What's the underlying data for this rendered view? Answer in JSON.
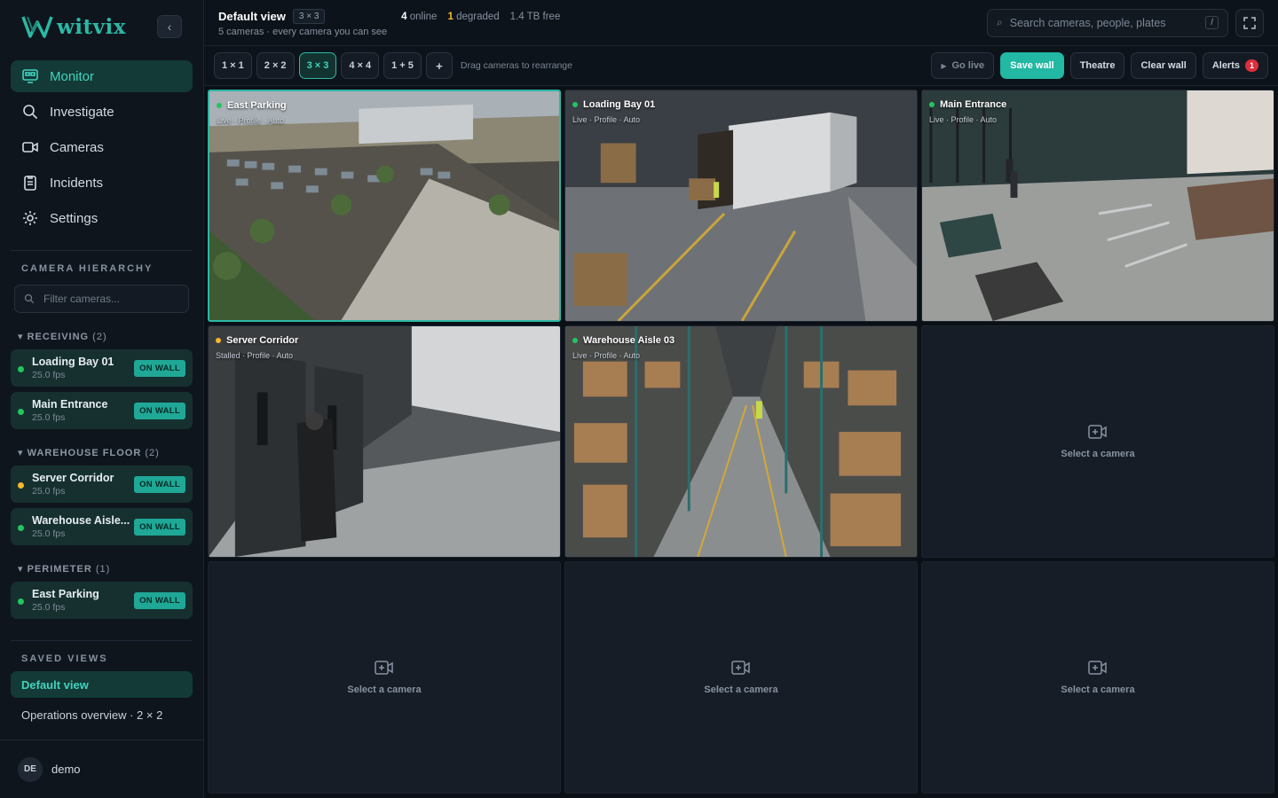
{
  "brand": {
    "name": "witvix"
  },
  "nav": [
    {
      "label": "Monitor",
      "icon": "monitor-icon",
      "active": true
    },
    {
      "label": "Investigate",
      "icon": "search-icon",
      "active": false
    },
    {
      "label": "Cameras",
      "icon": "camera-icon",
      "active": false
    },
    {
      "label": "Incidents",
      "icon": "clipboard-icon",
      "active": false
    },
    {
      "label": "Settings",
      "icon": "gear-icon",
      "active": false
    }
  ],
  "hierarchy": {
    "title": "CAMERA HIERARCHY",
    "filter_placeholder": "Filter cameras...",
    "groups": [
      {
        "name": "RECEIVING",
        "count": "(2)",
        "cameras": [
          {
            "name": "Loading Bay 01",
            "fps": "25.0 fps",
            "status": "online",
            "badge": "ON WALL"
          },
          {
            "name": "Main Entrance",
            "fps": "25.0 fps",
            "status": "online",
            "badge": "ON WALL"
          }
        ]
      },
      {
        "name": "WAREHOUSE FLOOR",
        "count": "(2)",
        "cameras": [
          {
            "name": "Server Corridor",
            "fps": "25.0 fps",
            "status": "degraded",
            "badge": "ON WALL"
          },
          {
            "name": "Warehouse Aisle...",
            "fps": "25.0 fps",
            "status": "online",
            "badge": "ON WALL"
          }
        ]
      },
      {
        "name": "PERIMETER",
        "count": "(1)",
        "cameras": [
          {
            "name": "East Parking",
            "fps": "25.0 fps",
            "status": "online",
            "badge": "ON WALL"
          }
        ]
      }
    ]
  },
  "saved_views": {
    "title": "SAVED VIEWS",
    "items": [
      {
        "label": "Default view",
        "active": true
      },
      {
        "label": "Operations overview · 2 × 2",
        "active": false
      }
    ]
  },
  "user": {
    "initials": "DE",
    "name": "demo"
  },
  "header": {
    "title": "Default view",
    "grid": "3 × 3",
    "subtitle": "5 cameras · every camera you can see",
    "online_count": "4",
    "online_label": "online",
    "degraded_count": "1",
    "degraded_label": "degraded",
    "storage": "1.4 TB free",
    "search_placeholder": "Search cameras, people, plates",
    "search_shortcut": "/"
  },
  "toolbar": {
    "layouts": [
      "1 × 1",
      "2 × 2",
      "3 × 3",
      "4 × 4",
      "1 + 5"
    ],
    "active_layout": "3 × 3",
    "add_label": "+",
    "hint": "Drag cameras to rearrange",
    "go_live": "Go live",
    "save_wall": "Save wall",
    "theatre": "Theatre",
    "clear_wall": "Clear wall",
    "alerts": "Alerts",
    "alerts_count": "1"
  },
  "tiles": [
    {
      "name": "East Parking",
      "meta": "Live · Profile · Auto",
      "status": "online",
      "scene": "parking",
      "selected": true
    },
    {
      "name": "Loading Bay 01",
      "meta": "Live · Profile · Auto",
      "status": "online",
      "scene": "loading"
    },
    {
      "name": "Main Entrance",
      "meta": "Live · Profile · Auto",
      "status": "online",
      "scene": "lobby"
    },
    {
      "name": "Server Corridor",
      "meta": "Stalled · Profile · Auto",
      "status": "degraded",
      "scene": "corridor"
    },
    {
      "name": "Warehouse Aisle 03",
      "meta": "Live · Profile · Auto",
      "status": "online",
      "scene": "aisle"
    },
    {
      "empty": true,
      "label": "Select a camera"
    },
    {
      "empty": true,
      "label": "Select a camera"
    },
    {
      "empty": true,
      "label": "Select a camera"
    },
    {
      "empty": true,
      "label": "Select a camera"
    }
  ],
  "colors": {
    "accent": "#2bb8a5",
    "online": "#22c55e",
    "degraded": "#f5b82e",
    "alert": "#dc2e3a"
  }
}
